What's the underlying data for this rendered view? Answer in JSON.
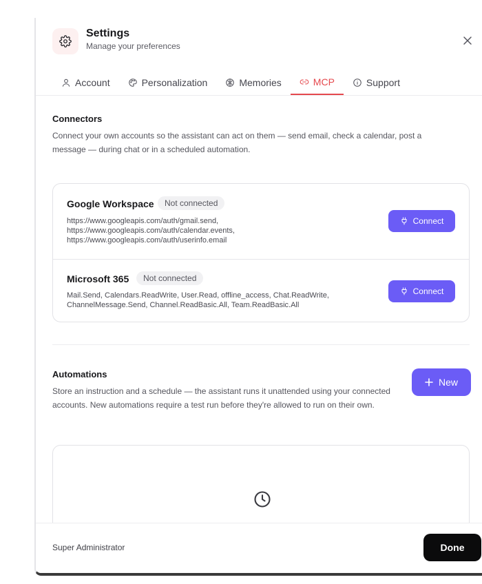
{
  "header": {
    "title": "Settings",
    "subtitle": "Manage your preferences"
  },
  "tabs": [
    {
      "label": "Account",
      "icon": "user-icon"
    },
    {
      "label": "Personalization",
      "icon": "palette-icon"
    },
    {
      "label": "Memories",
      "icon": "brain-icon"
    },
    {
      "label": "MCP",
      "icon": "link-icon",
      "active": true
    },
    {
      "label": "Support",
      "icon": "info-icon"
    }
  ],
  "connectors": {
    "title": "Connectors",
    "description": "Connect your own accounts so the assistant can act on them — send email, check a calendar, post a message — during chat or in a scheduled automation.",
    "items": [
      {
        "name": "Google Workspace",
        "status": "Not connected",
        "scopes": "https://www.googleapis.com/auth/gmail.send, https://www.googleapis.com/auth/calendar.events, https://www.googleapis.com/auth/userinfo.email",
        "button": "Connect"
      },
      {
        "name": "Microsoft 365",
        "status": "Not connected",
        "scopes": "Mail.Send, Calendars.ReadWrite, User.Read, offline_access, Chat.ReadWrite, ChannelMessage.Send, Channel.ReadBasic.All, Team.ReadBasic.All",
        "button": "Connect"
      }
    ]
  },
  "automations": {
    "title": "Automations",
    "description": "Store an instruction and a schedule — the assistant runs it unattended using your connected accounts. New automations require a test run before they're allowed to run on their own.",
    "new_button": "New",
    "empty_icon": "clock-icon"
  },
  "footer": {
    "user": "Super Administrator",
    "done_button": "Done"
  },
  "colors": {
    "accent": "#6b5cf6",
    "active_tab": "#e5484d",
    "done": "#0b0b0c"
  }
}
